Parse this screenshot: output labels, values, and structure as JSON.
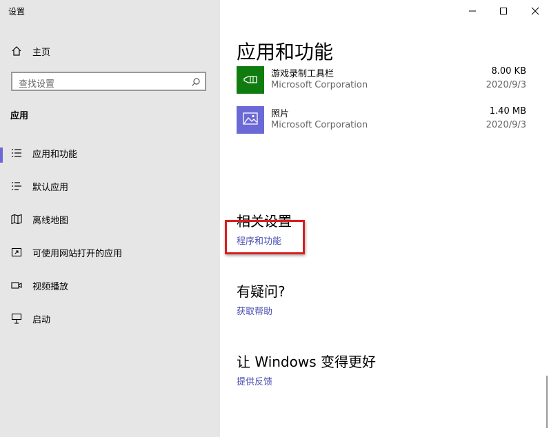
{
  "window": {
    "title": "设置"
  },
  "sidebar": {
    "home_label": "主页",
    "search_placeholder": "查找设置",
    "section": "应用",
    "items": [
      {
        "label": "应用和功能",
        "icon": "apps-list-icon",
        "active": true
      },
      {
        "label": "默认应用",
        "icon": "default-apps-icon",
        "active": false
      },
      {
        "label": "离线地图",
        "icon": "map-icon",
        "active": false
      },
      {
        "label": "可使用网站打开的应用",
        "icon": "open-link-icon",
        "active": false
      },
      {
        "label": "视频播放",
        "icon": "video-icon",
        "active": false
      },
      {
        "label": "启动",
        "icon": "startup-icon",
        "active": false
      }
    ]
  },
  "main": {
    "title": "应用和功能",
    "apps": [
      {
        "name": "游戏录制工具栏",
        "publisher": "Microsoft Corporation",
        "size": "8.00 KB",
        "date": "2020/9/3",
        "tile_color": "#107c10",
        "icon": "gamebar-icon"
      },
      {
        "name": "照片",
        "publisher": "Microsoft Corporation",
        "size": "1.40 MB",
        "date": "2020/9/3",
        "tile_color": "#6b69d6",
        "icon": "photos-icon"
      }
    ],
    "related": {
      "heading": "相关设置",
      "link": "程序和功能"
    },
    "question": {
      "heading": "有疑问?",
      "link": "获取帮助"
    },
    "feedback": {
      "heading": "让 Windows 变得更好",
      "link": "提供反馈"
    }
  },
  "colors": {
    "accent": "#6b69d6",
    "link": "#4a4fb3",
    "highlight": "#d81e1e"
  }
}
